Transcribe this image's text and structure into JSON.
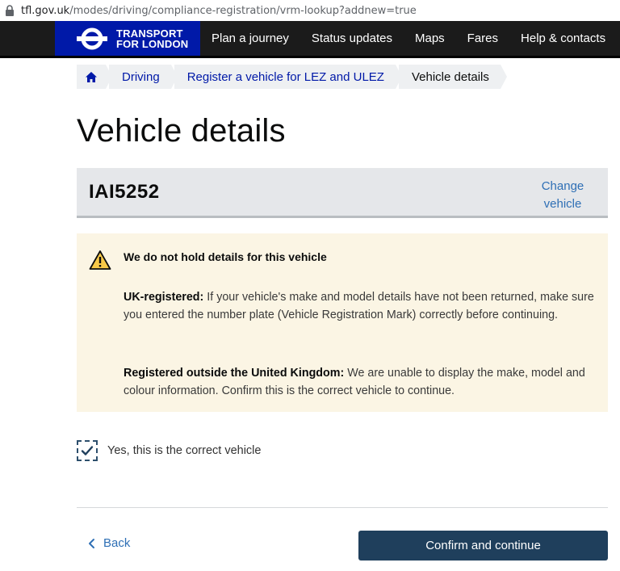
{
  "browser": {
    "url_host": "tfl.gov.uk",
    "url_path": "/modes/driving/compliance-registration/vrm-lookup?addnew=true"
  },
  "header": {
    "brand_line1": "TRANSPORT",
    "brand_line2": "FOR LONDON",
    "nav": [
      "Plan a journey",
      "Status updates",
      "Maps",
      "Fares",
      "Help & contacts"
    ]
  },
  "breadcrumb": {
    "items": [
      "Driving",
      "Register a vehicle for LEZ and ULEZ",
      "Vehicle details"
    ]
  },
  "page": {
    "title": "Vehicle details"
  },
  "vehicle": {
    "registration": "IAI5252",
    "change_line1": "Change",
    "change_line2": "vehicle"
  },
  "warning": {
    "title": "We do not hold details for this vehicle",
    "p1_bold": "UK-registered:",
    "p1_text": " If your vehicle's make and model details have not been returned, make sure you entered the number plate (Vehicle Registration Mark) correctly before continuing.",
    "p2_bold": "Registered outside the United Kingdom:",
    "p2_text": " We are unable to display the make, model and colour information. Confirm this is the correct vehicle to continue."
  },
  "confirmation": {
    "checkbox_label": "Yes, this is the correct vehicle",
    "checked": true
  },
  "actions": {
    "back_label": "Back",
    "confirm_label": "Confirm and continue"
  },
  "colors": {
    "brand_blue": "#0019a8",
    "primary_button": "#1f3f5c",
    "link": "#2e6fb5",
    "warning_bg": "#fbf5e4"
  }
}
